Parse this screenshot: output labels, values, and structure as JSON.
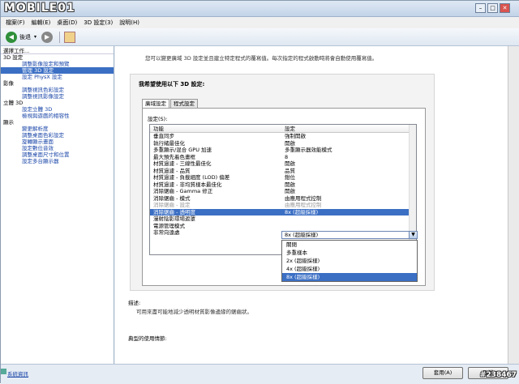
{
  "titlebar": {
    "logo": "MOBILE01"
  },
  "menu": [
    "檔案(F)",
    "編輯(E)",
    "桌面(D)",
    "3D 設定(3)",
    "說明(H)"
  ],
  "toolbar": {
    "back_label": "後退"
  },
  "sidebar": {
    "title": "選擇工作...",
    "items": [
      {
        "label": "3D 設定",
        "type": "cat"
      },
      {
        "label": "調整影像設定和預覽",
        "type": "sub"
      },
      {
        "label": "管理 3D 設定",
        "type": "sub",
        "selected": true
      },
      {
        "label": "設定 PhysX 設定",
        "type": "sub"
      },
      {
        "label": "影像",
        "type": "cat"
      },
      {
        "label": "調整視訊色彩設定",
        "type": "sub"
      },
      {
        "label": "調整視訊影像設定",
        "type": "sub"
      },
      {
        "label": "立體 3D",
        "type": "cat"
      },
      {
        "label": "設定立體 3D",
        "type": "sub"
      },
      {
        "label": "檢視與遊戲的相容性",
        "type": "sub"
      },
      {
        "label": "顯示",
        "type": "cat"
      },
      {
        "label": "變更解析度",
        "type": "sub"
      },
      {
        "label": "調整桌面色彩設定",
        "type": "sub"
      },
      {
        "label": "旋轉顯示畫面",
        "type": "sub"
      },
      {
        "label": "設定數位音效",
        "type": "sub"
      },
      {
        "label": "調整桌面尺寸和位置",
        "type": "sub"
      },
      {
        "label": "設定多台顯示器",
        "type": "sub"
      }
    ]
  },
  "main": {
    "intro": "您可以變更廣域 3D 設定並且建立特定程式的覆寫值。每次指定的程式啟動時將會自動使用覆寫值。",
    "panel_title": "我希望使用以下 3D 設定:",
    "tabs": [
      "廣域設定",
      "程式設定"
    ],
    "settings_label": "設定(S):",
    "grid_headers": [
      "功能",
      "設定"
    ],
    "rows": [
      {
        "feature": "垂直同步",
        "value": "強制開啟"
      },
      {
        "feature": "執行緒最佳化",
        "value": "開啟"
      },
      {
        "feature": "多重顯示/混合 GPU 加速",
        "value": "多重顯示器效能模式"
      },
      {
        "feature": "最大預先着色畫框",
        "value": "8"
      },
      {
        "feature": "材質過濾 - 三線性最佳化",
        "value": "開啟"
      },
      {
        "feature": "材質過濾 - 品質",
        "value": "品質"
      },
      {
        "feature": "材質過濾 - 負載細度 (LOD) 偏差",
        "value": "鉗位"
      },
      {
        "feature": "材質過濾 - 非均質樣本最佳化",
        "value": "開啟"
      },
      {
        "feature": "消除鋸齒 - Gamma 修正",
        "value": "開啟"
      },
      {
        "feature": "消除鋸齒 - 模式",
        "value": "由應用程式控制"
      },
      {
        "feature": "消除鋸齒 - 設定",
        "value": "由應用程式控制",
        "dim": true
      },
      {
        "feature": "消除鋸齒 - 透明度",
        "value": "8x (超級採樣)",
        "selected": true
      },
      {
        "feature": "漫射陰影環場遮罩",
        "value": ""
      },
      {
        "feature": "電源管理模式",
        "value": ""
      },
      {
        "feature": "非常向遠處",
        "value": ""
      }
    ],
    "dropdown": {
      "value": "8x (超級採樣)",
      "options": [
        "關閉",
        "多重樣本",
        "2x (超級採樣)",
        "4x (超級採樣)",
        "8x (超級採樣)"
      ],
      "highlighted": 4
    },
    "desc_label": "描述:",
    "desc_text": "可用來盡可能地減少透明材質影像邊緣的鋸齒狀。",
    "usage_label": "典型的使用情節:"
  },
  "status": {
    "sysinfo": "系統資訊",
    "apply": "套用(A)",
    "cancel": "取消"
  },
  "watermark": "#238467"
}
